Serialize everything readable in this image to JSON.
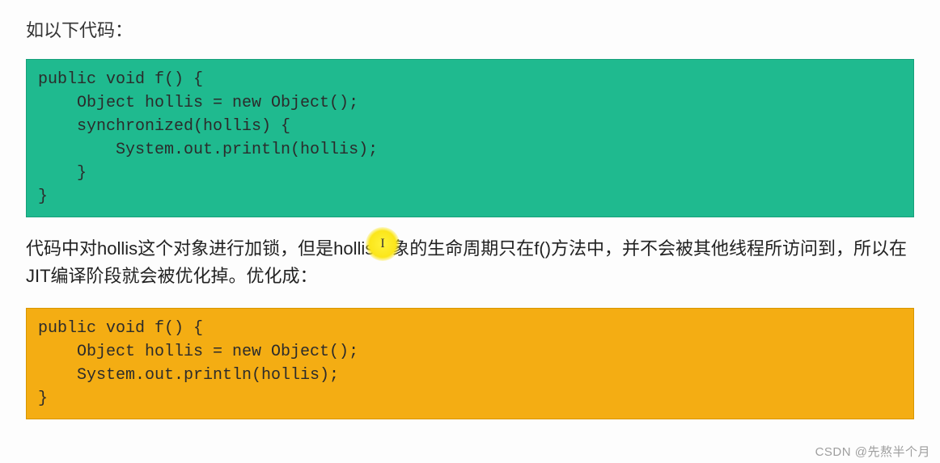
{
  "intro": "如以下代码：",
  "code1": "public void f() {\n    Object hollis = new Object();\n    synchronized(hollis) {\n        System.out.println(hollis);\n    }\n}",
  "middle": "代码中对hollis这个对象进行加锁，但是hollis对象的生命周期只在f()方法中，并不会被其他线程所访问到，所以在JIT编译阶段就会被优化掉。优化成：",
  "code2": "public void f() {\n    Object hollis = new Object();\n    System.out.println(hollis);\n}",
  "watermark": "CSDN @先熬半个月"
}
